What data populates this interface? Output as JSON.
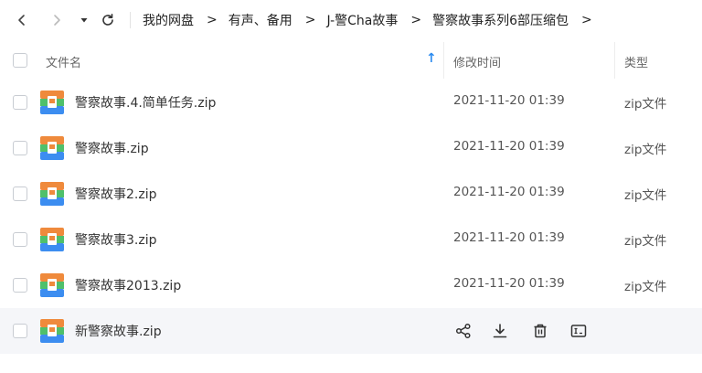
{
  "nav": {
    "breadcrumb": [
      "我的网盘",
      "有声、备用",
      "J-警Cha故事",
      "警察故事系列6部压缩包"
    ],
    "separator": ">"
  },
  "columns": {
    "name": "文件名",
    "modified": "修改时间",
    "type": "类型",
    "sort_arrow": "↑"
  },
  "files": [
    {
      "name": "警察故事.4.简单任务.zip",
      "time": "2021-11-20 01:39",
      "type": "zip文件"
    },
    {
      "name": "警察故事.zip",
      "time": "2021-11-20 01:39",
      "type": "zip文件"
    },
    {
      "name": "警察故事2.zip",
      "time": "2021-11-20 01:39",
      "type": "zip文件"
    },
    {
      "name": "警察故事3.zip",
      "time": "2021-11-20 01:39",
      "type": "zip文件"
    },
    {
      "name": "警察故事2013.zip",
      "time": "2021-11-20 01:39",
      "type": "zip文件"
    },
    {
      "name": "新警察故事.zip",
      "time": "",
      "type": ""
    }
  ],
  "hover_row_actions": [
    "share-icon",
    "download-icon",
    "delete-icon",
    "rename-icon"
  ],
  "colors": {
    "accent": "#2d8cf0",
    "hover_row": "#f5f6f9",
    "zip_orange": "#ef8a3c",
    "zip_green": "#4fc06b",
    "zip_blue": "#3c8df0"
  }
}
